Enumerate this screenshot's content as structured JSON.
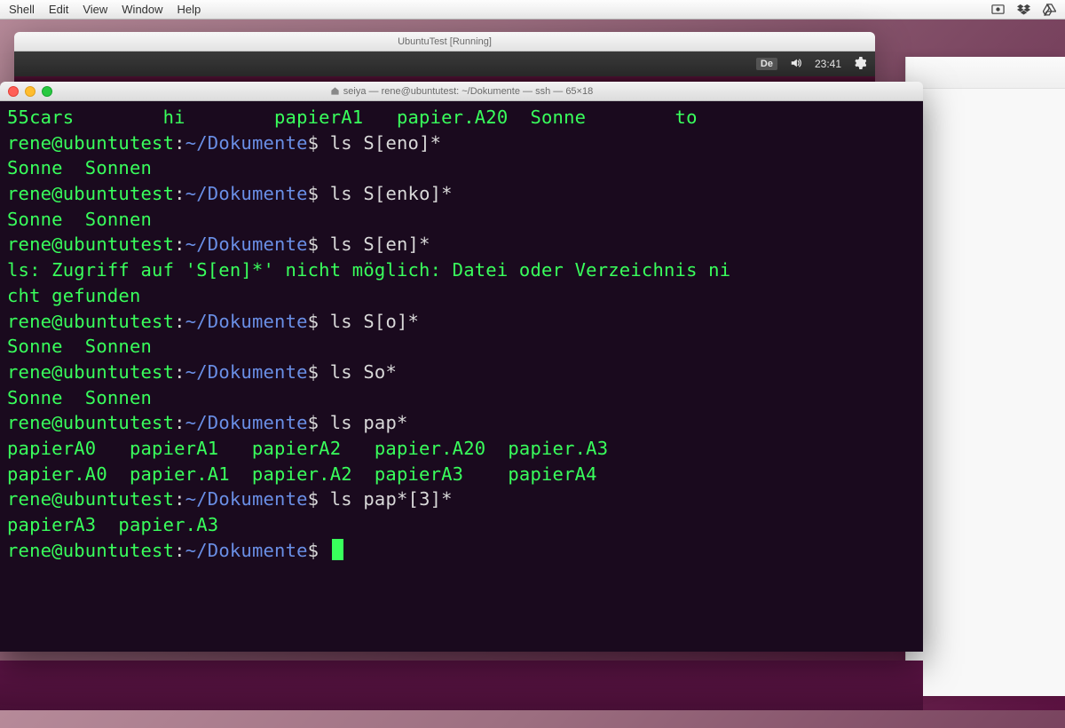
{
  "mac_menu": {
    "items": [
      "Shell",
      "Edit",
      "View",
      "Window",
      "Help"
    ]
  },
  "vm": {
    "title": "UbuntuTest [Running]"
  },
  "ubuntu_panel": {
    "lang": "De",
    "time": "23:41"
  },
  "terminal": {
    "title": "seiya — rene@ubuntutest: ~/Dokumente — ssh — 65×18",
    "prompt": {
      "user": "rene@ubuntutest",
      "path": "~/Dokumente",
      "sep1": ":",
      "sep2": "$"
    },
    "lines": [
      {
        "t": "out",
        "text": "55cars        hi        papierA1   papier.A20  Sonne        to"
      },
      {
        "t": "prompt",
        "cmd": "ls S[eno]*"
      },
      {
        "t": "out",
        "text": "Sonne  Sonnen"
      },
      {
        "t": "prompt",
        "cmd": "ls S[enko]*"
      },
      {
        "t": "out",
        "text": "Sonne  Sonnen"
      },
      {
        "t": "prompt",
        "cmd": "ls S[en]*"
      },
      {
        "t": "out",
        "text": "ls: Zugriff auf 'S[en]*' nicht möglich: Datei oder Verzeichnis ni"
      },
      {
        "t": "out",
        "text": "cht gefunden"
      },
      {
        "t": "prompt",
        "cmd": "ls S[o]*"
      },
      {
        "t": "out",
        "text": "Sonne  Sonnen"
      },
      {
        "t": "prompt",
        "cmd": "ls So*"
      },
      {
        "t": "out",
        "text": "Sonne  Sonnen"
      },
      {
        "t": "prompt",
        "cmd": "ls pap*"
      },
      {
        "t": "out",
        "text": "papierA0   papierA1   papierA2   papier.A20  papier.A3"
      },
      {
        "t": "out",
        "text": "papier.A0  papier.A1  papier.A2  papierA3    papierA4"
      },
      {
        "t": "prompt",
        "cmd": "ls pap*[3]*"
      },
      {
        "t": "out",
        "text": "papierA3  papier.A3"
      },
      {
        "t": "prompt",
        "cmd": "",
        "cursor": true
      }
    ]
  }
}
